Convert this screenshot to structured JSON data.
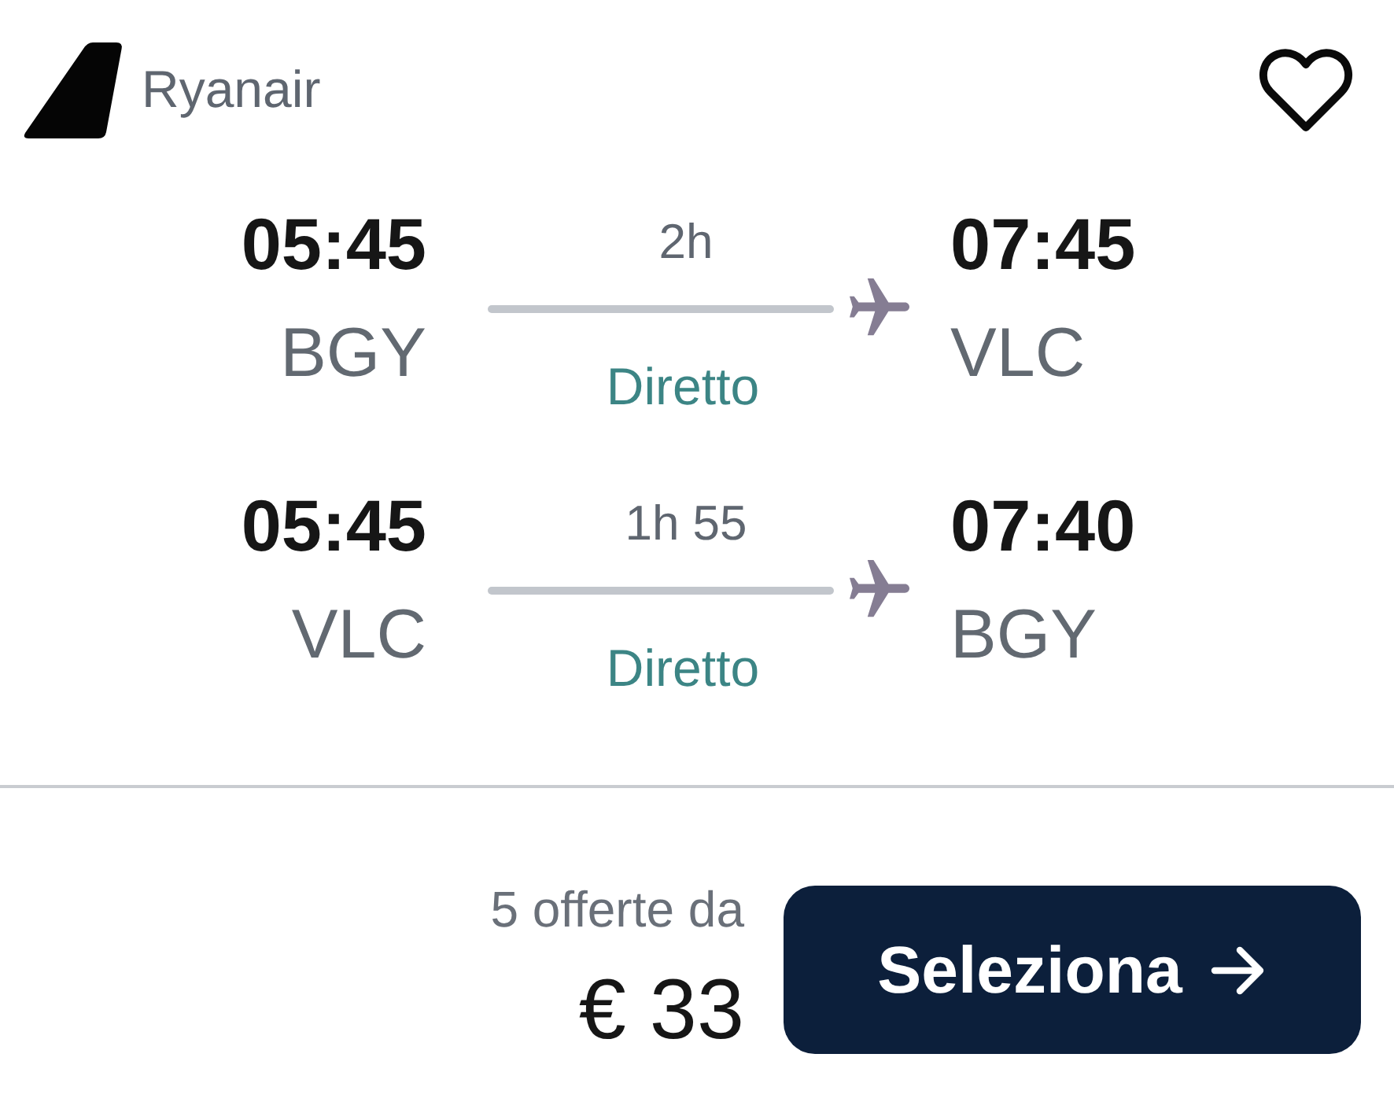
{
  "airline": {
    "name": "Ryanair"
  },
  "favorite": {
    "selected": false
  },
  "legs": [
    {
      "departure": {
        "time": "05:45",
        "airport": "BGY"
      },
      "duration": "2h",
      "stops": "Diretto",
      "arrival": {
        "time": "07:45",
        "airport": "VLC"
      }
    },
    {
      "departure": {
        "time": "05:45",
        "airport": "VLC"
      },
      "duration": "1h 55",
      "stops": "Diretto",
      "arrival": {
        "time": "07:40",
        "airport": "BGY"
      }
    }
  ],
  "offer": {
    "count_text": "5 offerte da",
    "price": "€ 33"
  },
  "button": {
    "label": "Seleziona"
  }
}
